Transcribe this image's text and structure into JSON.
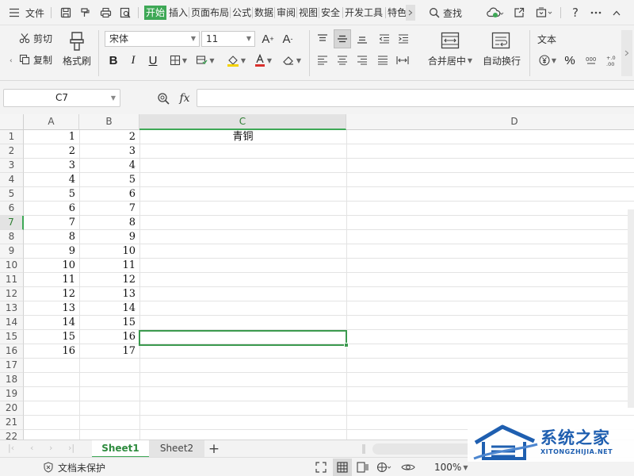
{
  "menubar": {
    "file_label": "文件",
    "tabs": [
      {
        "label": "开始",
        "active": true
      },
      {
        "label": "插入",
        "active": false
      },
      {
        "label": "页面布局",
        "active": false
      },
      {
        "label": "公式",
        "active": false
      },
      {
        "label": "数据",
        "active": false
      },
      {
        "label": "审阅",
        "active": false
      },
      {
        "label": "视图",
        "active": false
      },
      {
        "label": "安全",
        "active": false
      },
      {
        "label": "开发工具",
        "active": false
      },
      {
        "label": "特色",
        "active": false
      }
    ],
    "search_label": "查找",
    "icons": [
      "menu-icon",
      "save-icon",
      "format-painter-icon",
      "print-icon",
      "print-preview-icon",
      "undo-icon",
      "redo-icon",
      "cloud-sync-icon",
      "share-icon",
      "collapse-icon",
      "help-icon",
      "more-icon",
      "minimize-ribbon-icon"
    ]
  },
  "ribbon": {
    "cut_label": "剪切",
    "copy_label": "复制",
    "format_painter_label": "格式刷",
    "font_name": "宋体",
    "font_size": "11",
    "merge_center_label": "合并居中",
    "wrap_text_label": "自动换行",
    "number_format": "文本",
    "percent_symbol": "%",
    "font_buttons": [
      "B",
      "I",
      "U"
    ],
    "grow_font": "A",
    "shrink_font": "A"
  },
  "formula_bar": {
    "name_box": "C7",
    "fx_label": "fx",
    "formula_value": ""
  },
  "grid": {
    "columns": [
      "A",
      "B",
      "C",
      "D"
    ],
    "selected_column": "C",
    "rows": [
      "1",
      "2",
      "3",
      "4",
      "5",
      "6",
      "7",
      "8",
      "9",
      "10",
      "11",
      "12",
      "13",
      "14",
      "15",
      "16",
      "17",
      "18",
      "19",
      "20",
      "21",
      "22"
    ],
    "selected_row": "7",
    "col_a": [
      "1",
      "2",
      "3",
      "4",
      "5",
      "6",
      "7",
      "8",
      "9",
      "10",
      "11",
      "12",
      "13",
      "14",
      "15",
      "16"
    ],
    "col_b": [
      "2",
      "3",
      "4",
      "5",
      "6",
      "7",
      "8",
      "9",
      "10",
      "11",
      "12",
      "13",
      "14",
      "15",
      "16",
      "17"
    ],
    "c1": "青铜"
  },
  "sheets": {
    "tabs": [
      "Sheet1",
      "Sheet2"
    ],
    "active": "Sheet1",
    "add_label": "+"
  },
  "status": {
    "protect_label": "文档未保护",
    "zoom": "100%"
  },
  "watermark": {
    "title": "系统之家",
    "url": "XITONGZHIJIA.NET"
  },
  "colors": {
    "accent_green": "#3ea856",
    "watermark_blue": "#1f5fb0",
    "font_color_red": "#d9302c",
    "highlight_yellow": "#f5d300"
  }
}
